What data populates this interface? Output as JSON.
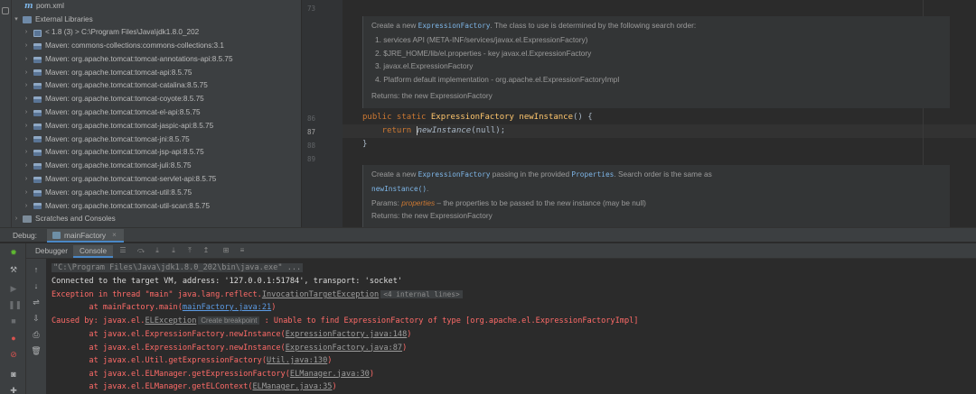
{
  "project_tree": {
    "pom_file": "pom.xml",
    "external_libraries": "External Libraries",
    "jdk_entry": "< 1.8 (3) >  C:\\Program Files\\Java\\jdk1.8.0_202",
    "libraries": [
      "Maven: commons-collections:commons-collections:3.1",
      "Maven: org.apache.tomcat:tomcat-annotations-api:8.5.75",
      "Maven: org.apache.tomcat:tomcat-api:8.5.75",
      "Maven: org.apache.tomcat:tomcat-catalina:8.5.75",
      "Maven: org.apache.tomcat:tomcat-coyote:8.5.75",
      "Maven: org.apache.tomcat:tomcat-el-api:8.5.75",
      "Maven: org.apache.tomcat:tomcat-jaspic-api:8.5.75",
      "Maven: org.apache.tomcat:tomcat-jni:8.5.75",
      "Maven: org.apache.tomcat:tomcat-jsp-api:8.5.75",
      "Maven: org.apache.tomcat:tomcat-juli:8.5.75",
      "Maven: org.apache.tomcat:tomcat-servlet-api:8.5.75",
      "Maven: org.apache.tomcat:tomcat-util:8.5.75",
      "Maven: org.apache.tomcat:tomcat-util-scan:8.5.75"
    ],
    "scratches": "Scratches and Consoles"
  },
  "editor": {
    "line_numbers": {
      "l73": "73",
      "l86": "86",
      "l87": "87",
      "l88": "88",
      "l89": "89"
    },
    "doc1": {
      "intro_pre": "Create a new ",
      "intro_code": "ExpressionFactory",
      "intro_post": ". The class to use is determined by the following search order:",
      "items": [
        "1.  services API (META-INF/services/javax.el.ExpressionFactory)",
        "2.  $JRE_HOME/lib/el.properties - key javax.el.ExpressionFactory",
        "3.  javax.el.ExpressionFactory",
        "4.  Platform default implementation - org.apache.el.ExpressionFactoryImpl"
      ],
      "returns": "Returns: the new ExpressionFactory"
    },
    "code": {
      "l86_kw": "public static ",
      "l86_type": "ExpressionFactory ",
      "l86_name": "newInstance",
      "l86_rest": "() {",
      "l87_kw": "    return ",
      "l87_call": "newInstance",
      "l87_rest": "(null);",
      "l88": "}"
    },
    "doc2": {
      "p1": "Create a new ",
      "c1": "ExpressionFactory",
      "p2": " passing in the provided ",
      "c2": "Properties",
      "p3": ". Search order is the same as",
      "c3": "newInstance()",
      "p4": ".",
      "params_label": "Params:  ",
      "params_name": "properties",
      "params_desc": " – the properties to be passed to the new instance (may be null)",
      "returns": "Returns: the new ExpressionFactory"
    }
  },
  "debug": {
    "label": "Debug:",
    "session_tab": "mainFactory",
    "close": "×",
    "subtabs": {
      "debugger": "Debugger",
      "console": "Console"
    }
  },
  "console": {
    "cmd": "\"C:\\Program Files\\Java\\jdk1.8.0_202\\bin\\java.exe\" ...",
    "connected": "Connected to the target VM, address: '127.0.0.1:51784', transport: 'socket'",
    "exc_pre": "Exception in thread \"main\" java.lang.reflect.",
    "exc_link": "InvocationTargetException",
    "exc_chip": "<4 internal lines>",
    "at_main_pre": "\tat mainFactory.main(",
    "at_main_link": "mainFactory.java:21",
    "at_main_post": ")",
    "caused_pre": "Caused by: javax.el.",
    "caused_link": "ELException",
    "caused_chip": "Create breakpoint",
    "caused_post": " : Unable to find ExpressionFactory of type [org.apache.el.ExpressionFactoryImpl]",
    "stack": [
      {
        "pre": "\tat javax.el.ExpressionFactory.newInstance(",
        "link": "ExpressionFactory.java:148",
        "post": ")"
      },
      {
        "pre": "\tat javax.el.ExpressionFactory.newInstance(",
        "link": "ExpressionFactory.java:87",
        "post": ")"
      },
      {
        "pre": "\tat javax.el.Util.getExpressionFactory(",
        "link": "Util.java:130",
        "post": ")"
      },
      {
        "pre": "\tat javax.el.ELManager.getExpressionFactory(",
        "link": "ELManager.java:30",
        "post": ")"
      },
      {
        "pre": "\tat javax.el.ELManager.getELContext(",
        "link": "ELManager.java:35",
        "post": ")"
      }
    ]
  },
  "colors": {
    "background": "#2b2b2b",
    "panel": "#3c3f41",
    "error": "#ff6b68",
    "keyword": "#cc7832",
    "method": "#ffc66d",
    "accent": "#4a88c7"
  }
}
